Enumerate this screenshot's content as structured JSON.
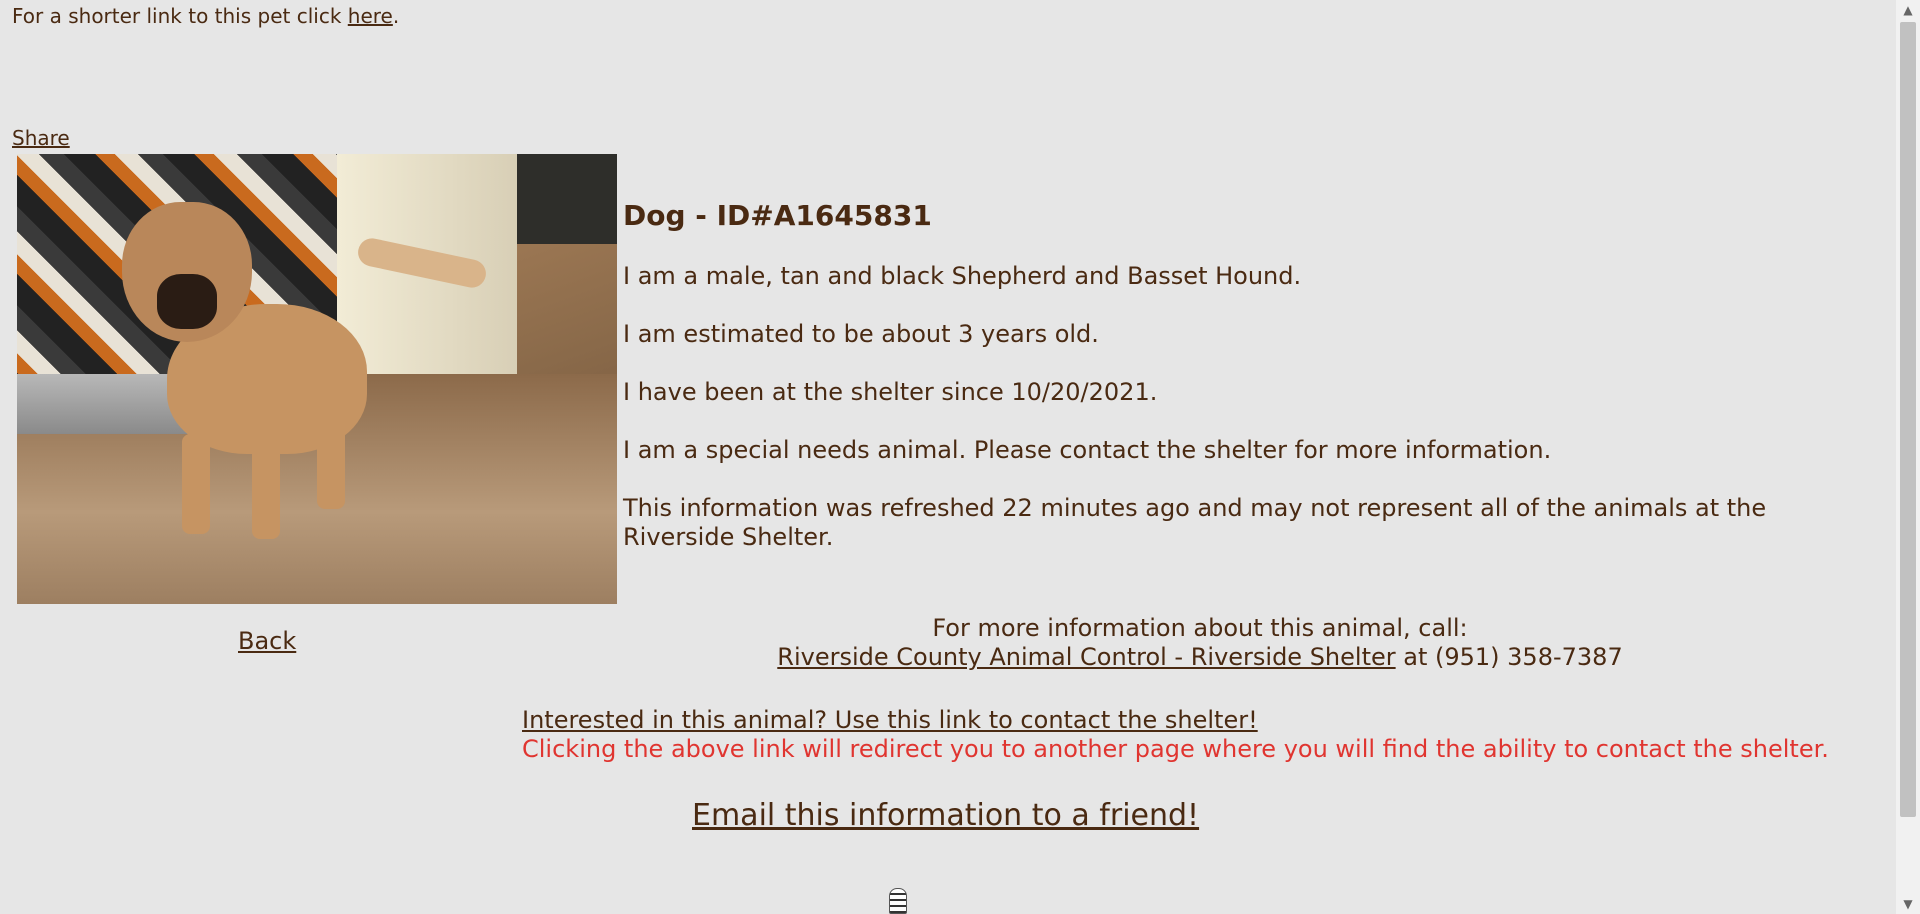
{
  "header": {
    "short_link_text": "For a shorter link to this pet click ",
    "short_link_label": "here",
    "short_link_suffix": ".",
    "share_label": "Share"
  },
  "animal": {
    "photo_description_icon": "dog-photo",
    "title": "Dog - ID#A1645831",
    "description_1": "I am a male, tan and black Shepherd and Basset Hound.",
    "description_2": "I am estimated to be about 3 years old.",
    "description_3": "I have been at the shelter since 10/20/2021.",
    "description_4": "I am a special needs animal. Please contact the shelter for more information.",
    "refresh_note": "This information was refreshed 22 minutes ago and may not represent all of the animals at the Riverside Shelter."
  },
  "nav": {
    "back_label": "Back"
  },
  "contact": {
    "call_text": "For more information about this animal, call:",
    "shelter_link": "Riverside County Animal Control - Riverside Shelter",
    "phone_text": " at (951) 358-7387",
    "interested_link": "Interested in this animal? Use this link to contact the shelter!",
    "redirect_warning": "Clicking the above link will redirect you to another page where you will find the ability to contact the shelter.",
    "email_link": "Email this information to a friend!"
  },
  "colors": {
    "background": "#e6e6e6",
    "text": "#4a2a12",
    "warning": "#e03530"
  }
}
